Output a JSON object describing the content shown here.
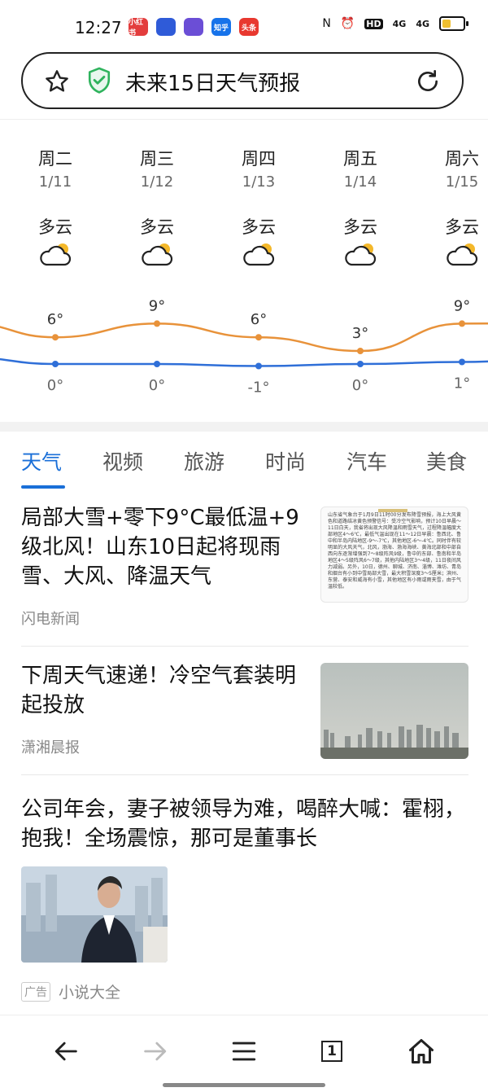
{
  "status": {
    "time": "12:27",
    "apps": [
      {
        "name": "xiaohongshu-icon",
        "label": "小红书",
        "color": "#e33d3d"
      },
      {
        "name": "baidu-icon",
        "label": "",
        "color": "#2f5bd8"
      },
      {
        "name": "app-purple-icon",
        "label": "",
        "color": "#6b4ed6"
      },
      {
        "name": "zhihu-icon",
        "label": "知乎",
        "color": "#1773ea"
      },
      {
        "name": "toutiao-icon",
        "label": "头条",
        "color": "#e8382f"
      }
    ],
    "indicators": [
      "N",
      "⏰",
      "HD",
      "4G",
      "4G"
    ]
  },
  "search": {
    "title": "未来15日天气预报"
  },
  "forecast": {
    "days": [
      {
        "day": "周二",
        "date": "1/11",
        "condition": "多云",
        "high": "6°",
        "low": "0°"
      },
      {
        "day": "周三",
        "date": "1/12",
        "condition": "多云",
        "high": "9°",
        "low": "0°"
      },
      {
        "day": "周四",
        "date": "1/13",
        "condition": "多云",
        "high": "6°",
        "low": "-1°"
      },
      {
        "day": "周五",
        "date": "1/14",
        "condition": "多云",
        "high": "3°",
        "low": "0°"
      },
      {
        "day": "周六",
        "date": "1/15",
        "condition": "多云",
        "high": "9°",
        "low": "1°"
      }
    ],
    "high_values": [
      6,
      9,
      6,
      3,
      9
    ],
    "low_values": [
      0,
      0,
      -1,
      0,
      1
    ],
    "high_color": "#e8923a",
    "low_color": "#2f6fd8"
  },
  "tabs": [
    "天气",
    "视频",
    "旅游",
    "时尚",
    "汽车",
    "美食"
  ],
  "articles": [
    {
      "title": "局部大雪+零下9°C最低温+9级北风！山东10日起将现雨雪、大风、降温天气",
      "source": "闪电新闻",
      "thumb_text": "山东省气象台于1月9日11时00分发布降雪预报，海上大风黄色和道路结冰黄色预警信号：受冷空气影响，预计10日早晨～11日白天，我省将出现大风降温和雨雪天气，过程降温幅度大部地区4～6℃，最低气温出现在11～12日早晨：鲁西北、鲁中和半岛内陆地区-9～-7℃，其他地区-6～-4℃。同时伴有较明显的大风天气，北风，渤海、渤海海峡、黄海北部和中部自西向东逐渐增强到7～8级阵风9级，鲁中的东部、鲁南和半岛地区4～5级阵风6～7级，其他内陆地区3～4级，11日夜间风力减弱。另外，10日，德州、聊城、济南、淄博、潍坊、青岛和烟台有小到中雪局部大雪，最大积雪深度3～5厘米；滨州、东营、泰安和威海有小雪，其他地区有小雨或雨夹雪，由于气温较低。"
    },
    {
      "title": "下周天气速递！冷空气套装明起投放",
      "source": "潇湘晨报"
    },
    {
      "title": "公司年会，妻子被领导为难，喝醉大喊：霍栩，抱我！全场震惊，那可是董事长",
      "ad_label": "广告",
      "source": "小说大全"
    }
  ]
}
